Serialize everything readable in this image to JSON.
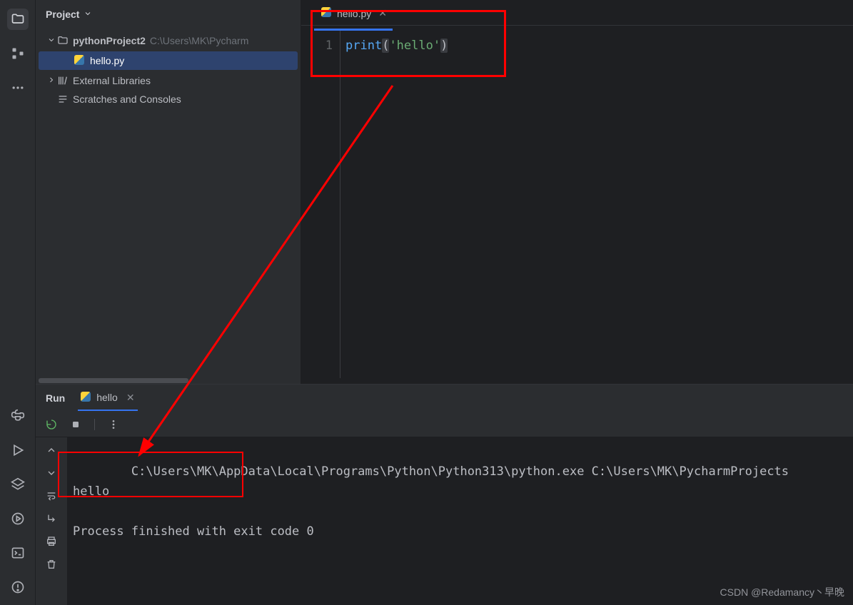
{
  "iconBar": {
    "top": [
      "folder-icon",
      "grid-icon",
      "structure-icon",
      "more-icon"
    ],
    "bottom": [
      "python-icon",
      "run-icon",
      "layers-icon",
      "services-icon",
      "terminal-icon",
      "problems-icon"
    ]
  },
  "projectPanel": {
    "title": "Project",
    "tree": {
      "root": {
        "name": "pythonProject2",
        "path": "C:\\Users\\MK\\Pycharm"
      },
      "file": "hello.py",
      "external": "External Libraries",
      "scratches": "Scratches and Consoles"
    }
  },
  "editor": {
    "tab": {
      "name": "hello.py"
    },
    "code": {
      "lineNum": "1",
      "fn": "print",
      "open": "(",
      "str": "'hello'",
      "close": ")"
    }
  },
  "runPanel": {
    "title": "Run",
    "tab": "hello",
    "output": {
      "cmd": "C:\\Users\\MK\\AppData\\Local\\Programs\\Python\\Python313\\python.exe C:\\Users\\MK\\PycharmProjects",
      "result": "hello",
      "exit": "Process finished with exit code 0"
    }
  },
  "watermark": "CSDN @Redamancy丶早晚"
}
